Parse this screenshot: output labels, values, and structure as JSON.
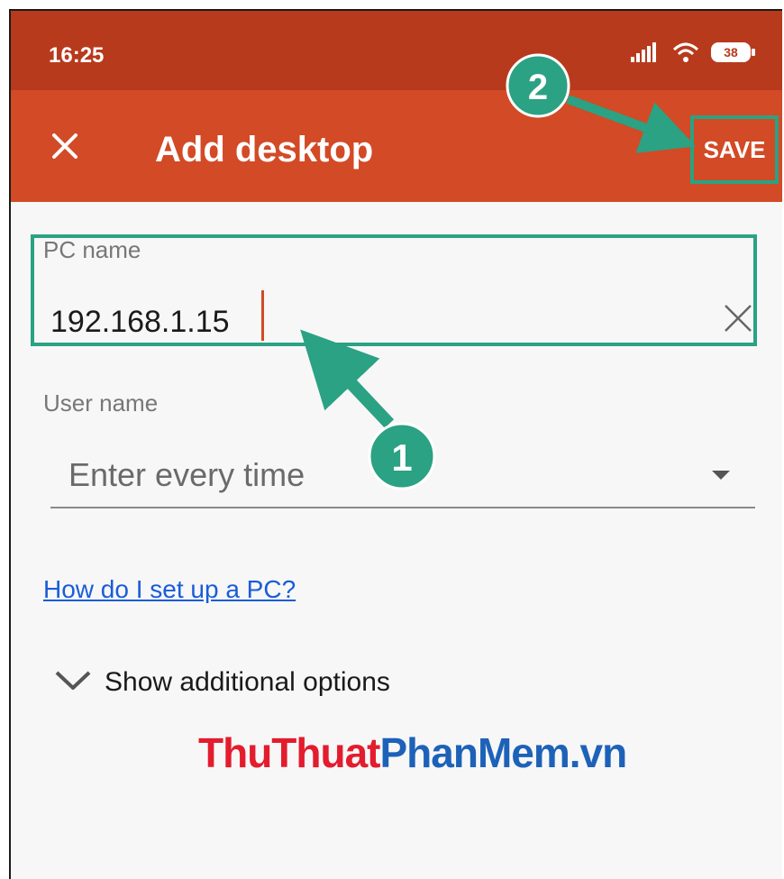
{
  "status_bar": {
    "time": "16:25",
    "battery_level": "38",
    "icons": [
      "signal-icon",
      "wifi-icon",
      "battery-icon"
    ]
  },
  "app_bar": {
    "title": "Add desktop",
    "close_icon": "close-icon",
    "save_label": "SAVE"
  },
  "form": {
    "pc_name": {
      "label": "PC name",
      "value": "192.168.1.15",
      "clear_icon": "close-icon"
    },
    "user_name": {
      "label": "User name",
      "selected": "Enter every time",
      "dropdown_icon": "triangle-down-icon"
    },
    "help_link": "How do I set up a PC?",
    "additional_options": {
      "label": "Show additional options",
      "icon": "chevron-down-icon"
    }
  },
  "annotations": {
    "step1": "1",
    "step2": "2"
  },
  "watermark": {
    "part1": "ThuThuat",
    "part2": "PhanMem.vn"
  },
  "colors": {
    "status_bar": "#b83a1d",
    "app_bar": "#d24a26",
    "annotation": "#2aa283",
    "link": "#1a5cd8"
  }
}
